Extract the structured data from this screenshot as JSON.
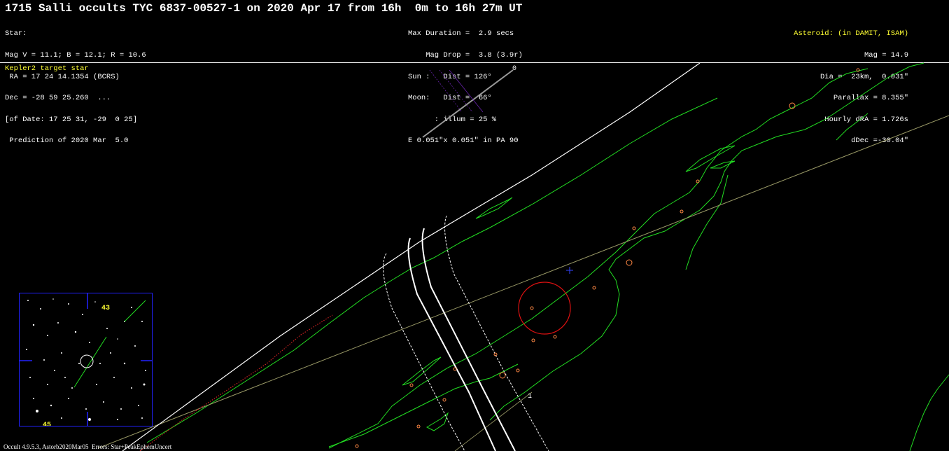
{
  "title": "1715 Salli occults TYC 6837-00527-1 on 2020 Apr 17 from 16h  0m to 16h 27m UT",
  "star_block": {
    "lines": [
      "Star:",
      "Mag V = 11.1; B = 12.1; R = 10.6",
      " RA = 17 24 14.1354 (BCRS)",
      "Dec = -28 59 25.260  ...",
      "[of Date: 17 25 31, -29  0 25]",
      " Prediction of 2020 Mar  5.0"
    ]
  },
  "event_block": {
    "lines": [
      "Max Duration =  2.9 secs",
      "    Mag Drop =  3.8 (3.9r)",
      "Sun :   Dist = 126°",
      "Moon:   Dist =  66°",
      "      : illum = 25 %",
      "E 0.051\"x 0.051\" in PA 90"
    ]
  },
  "asteroid_block": {
    "header": "Asteroid: (in DAMIT, ISAM)",
    "lines": [
      "Mag = 14.9",
      "Dia =  23km,  0.031\"",
      "Parallax = 8.355\"",
      "Hourly dRA = 1.726s",
      "dDec =-30.04\""
    ]
  },
  "note": "Kepler2 target star",
  "footer": "Occult 4.9.5.3, Astorb2020Mar05  Errors: Star+PeakEphemUncert",
  "path_labels": {
    "start": "0",
    "end": "1"
  },
  "inset": {
    "label_top": "43",
    "label_bottom": "45"
  },
  "colors": {
    "background": "#000000",
    "text": "#ffffff",
    "highlight": "#ffff33",
    "coast": "#22dd22",
    "path_center": "#ffffff",
    "site_marker": "#ff8844",
    "sun_circle": "#dd1111",
    "inset_border": "#2222ff",
    "center_cross": "#3344ff"
  }
}
